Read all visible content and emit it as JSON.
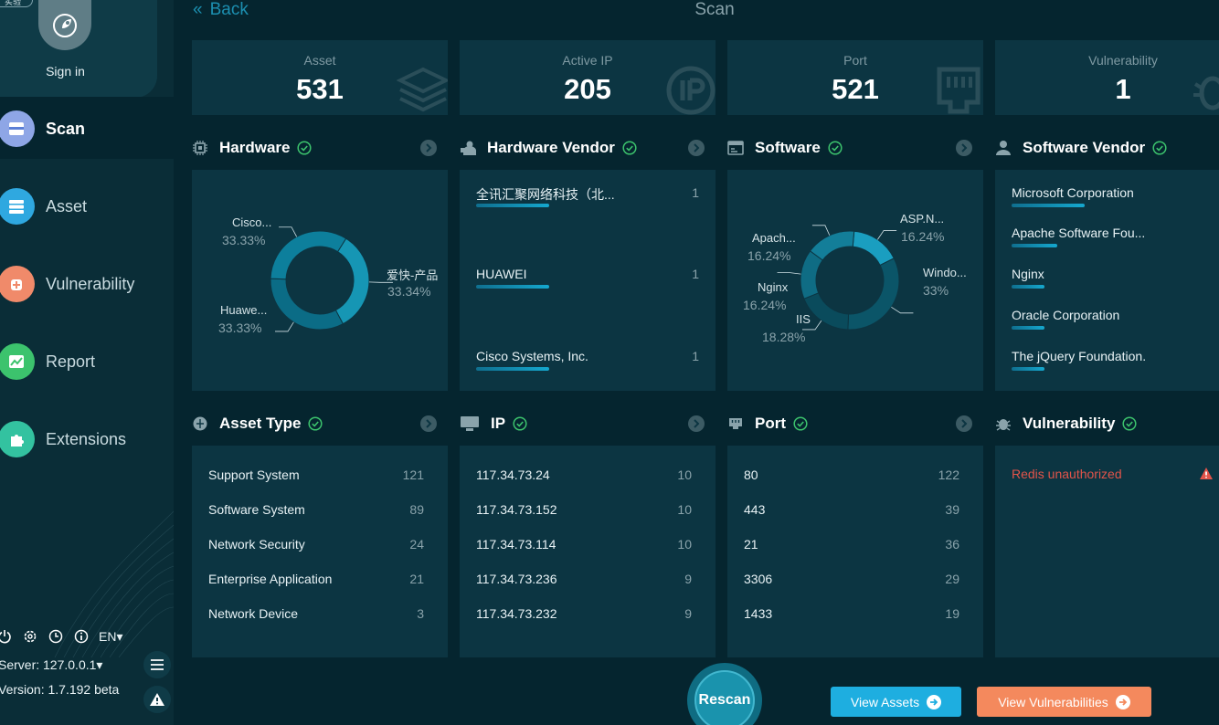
{
  "sidebar": {
    "version_pill": "实验",
    "signin_label": "Sign in",
    "nav": [
      {
        "label": "Scan",
        "icon": "scan-icon",
        "color": "#5b7fd6"
      },
      {
        "label": "Asset",
        "icon": "asset-icon",
        "color": "#2fa8e0"
      },
      {
        "label": "Vulnerability",
        "icon": "vulnerability-icon",
        "color": "#f08a6a"
      },
      {
        "label": "Report",
        "icon": "report-icon",
        "color": "#3cc36d"
      },
      {
        "label": "Extensions",
        "icon": "extensions-icon",
        "color": "#33c2a0"
      }
    ],
    "language": "EN",
    "server": "Server: 127.0.0.1",
    "version": "Version: 1.7.192 beta"
  },
  "header": {
    "back": "Back",
    "title": "Scan"
  },
  "stats": [
    {
      "label": "Asset",
      "value": "531"
    },
    {
      "label": "Active IP",
      "value": "205"
    },
    {
      "label": "Port",
      "value": "521"
    },
    {
      "label": "Vulnerability",
      "value": "1"
    }
  ],
  "sections": {
    "hardware": "Hardware",
    "hardware_vendor": "Hardware Vendor",
    "software": "Software",
    "software_vendor": "Software Vendor",
    "asset_type": "Asset Type",
    "ip": "IP",
    "port": "Port",
    "vulnerability": "Vulnerability"
  },
  "hardware_chart": {
    "type": "pie",
    "slices": [
      {
        "label": "爱快-产品",
        "pct": "33.34%",
        "value": 33.34
      },
      {
        "label": "Huawe...",
        "pct": "33.33%",
        "value": 33.33
      },
      {
        "label": "Cisco...",
        "pct": "33.33%",
        "value": 33.33
      }
    ]
  },
  "software_chart": {
    "type": "pie",
    "slices": [
      {
        "label": "ASP.N...",
        "pct": "16.24%",
        "value": 16.24
      },
      {
        "label": "Windo...",
        "pct": "33%",
        "value": 33
      },
      {
        "label": "IIS",
        "pct": "18.28%",
        "value": 18.28
      },
      {
        "label": "Nginx",
        "pct": "16.24%",
        "value": 16.24
      },
      {
        "label": "Apach...",
        "pct": "16.24%",
        "value": 16.24
      }
    ]
  },
  "hardware_vendor": [
    {
      "name": "全讯汇聚网络科技（北...",
      "count": "1"
    },
    {
      "name": "HUAWEI",
      "count": "1"
    },
    {
      "name": "Cisco Systems, Inc.",
      "count": "1"
    }
  ],
  "software_vendor": [
    {
      "name": "Microsoft Corporation",
      "bar": 0.4
    },
    {
      "name": "Apache Software Fou...",
      "bar": 0.25
    },
    {
      "name": "Nginx",
      "bar": 0.18
    },
    {
      "name": "Oracle Corporation",
      "bar": 0.18
    },
    {
      "name": "The jQuery Foundation.",
      "bar": 0.18
    }
  ],
  "asset_type": [
    {
      "name": "Support System",
      "count": "121"
    },
    {
      "name": "Software System",
      "count": "89"
    },
    {
      "name": "Network Security",
      "count": "24"
    },
    {
      "name": "Enterprise Application",
      "count": "21"
    },
    {
      "name": "Network Device",
      "count": "3"
    }
  ],
  "ip": [
    {
      "name": "117.34.73.24",
      "count": "10"
    },
    {
      "name": "117.34.73.152",
      "count": "10"
    },
    {
      "name": "117.34.73.114",
      "count": "10"
    },
    {
      "name": "117.34.73.236",
      "count": "9"
    },
    {
      "name": "117.34.73.232",
      "count": "9"
    }
  ],
  "port": [
    {
      "name": "80",
      "count": "122"
    },
    {
      "name": "443",
      "count": "39"
    },
    {
      "name": "21",
      "count": "36"
    },
    {
      "name": "3306",
      "count": "29"
    },
    {
      "name": "1433",
      "count": "19"
    }
  ],
  "vulnerabilities": [
    {
      "name": "Redis unauthorized"
    }
  ],
  "actions": {
    "rescan": "Rescan",
    "view_assets": "View Assets",
    "view_vulnerabilities": "View Vulnerabilities"
  },
  "colors": {
    "accent": "#1c8fb0",
    "ok_green": "#3cc36d",
    "danger": "#e2544a",
    "assets_button": "#1eaee0",
    "vulns_button": "#f4895d"
  }
}
